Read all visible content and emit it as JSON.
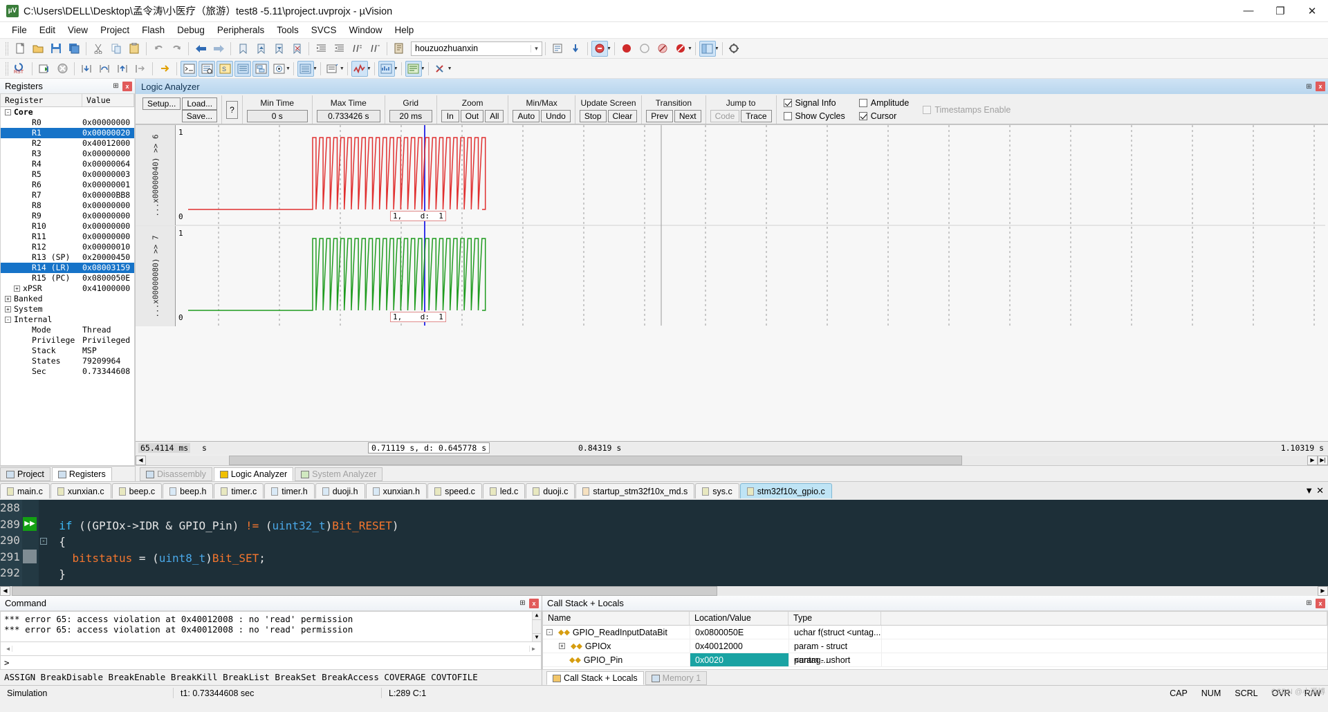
{
  "window": {
    "title": "C:\\Users\\DELL\\Desktop\\孟令涛\\小医疗（旅游）test8 -5.11\\project.uvprojx - µVision",
    "logo_text": "µV",
    "minimize": "—",
    "maximize": "❐",
    "close": "✕"
  },
  "menu": [
    "File",
    "Edit",
    "View",
    "Project",
    "Flash",
    "Debug",
    "Peripherals",
    "Tools",
    "SVCS",
    "Window",
    "Help"
  ],
  "toolbar": {
    "target_combo": "houzuozhuanxin",
    "combo_arrow": "▼"
  },
  "registers_pane": {
    "caption": "Registers",
    "pin": "⊞",
    "close": "x",
    "headers": [
      "Register",
      "Value"
    ],
    "rows": [
      {
        "name": "Core",
        "value": "",
        "indent": 0,
        "toggle": "-",
        "bold": true,
        "selected": false
      },
      {
        "name": "R0",
        "value": "0x00000000",
        "indent": 2,
        "toggle": "",
        "bold": false,
        "selected": false
      },
      {
        "name": "R1",
        "value": "0x00000020",
        "indent": 2,
        "toggle": "",
        "bold": false,
        "selected": true
      },
      {
        "name": "R2",
        "value": "0x40012000",
        "indent": 2,
        "toggle": "",
        "bold": false,
        "selected": false
      },
      {
        "name": "R3",
        "value": "0x00000000",
        "indent": 2,
        "toggle": "",
        "bold": false,
        "selected": false
      },
      {
        "name": "R4",
        "value": "0x00000064",
        "indent": 2,
        "toggle": "",
        "bold": false,
        "selected": false
      },
      {
        "name": "R5",
        "value": "0x00000003",
        "indent": 2,
        "toggle": "",
        "bold": false,
        "selected": false
      },
      {
        "name": "R6",
        "value": "0x00000001",
        "indent": 2,
        "toggle": "",
        "bold": false,
        "selected": false
      },
      {
        "name": "R7",
        "value": "0x00000BB8",
        "indent": 2,
        "toggle": "",
        "bold": false,
        "selected": false
      },
      {
        "name": "R8",
        "value": "0x00000000",
        "indent": 2,
        "toggle": "",
        "bold": false,
        "selected": false
      },
      {
        "name": "R9",
        "value": "0x00000000",
        "indent": 2,
        "toggle": "",
        "bold": false,
        "selected": false
      },
      {
        "name": "R10",
        "value": "0x00000000",
        "indent": 2,
        "toggle": "",
        "bold": false,
        "selected": false
      },
      {
        "name": "R11",
        "value": "0x00000000",
        "indent": 2,
        "toggle": "",
        "bold": false,
        "selected": false
      },
      {
        "name": "R12",
        "value": "0x00000010",
        "indent": 2,
        "toggle": "",
        "bold": false,
        "selected": false
      },
      {
        "name": "R13 (SP)",
        "value": "0x20000450",
        "indent": 2,
        "toggle": "",
        "bold": false,
        "selected": false
      },
      {
        "name": "R14 (LR)",
        "value": "0x08003159",
        "indent": 2,
        "toggle": "",
        "bold": false,
        "selected": true
      },
      {
        "name": "R15 (PC)",
        "value": "0x0800050E",
        "indent": 2,
        "toggle": "",
        "bold": false,
        "selected": false
      },
      {
        "name": "xPSR",
        "value": "0x41000000",
        "indent": 1,
        "toggle": "+",
        "bold": false,
        "selected": false
      },
      {
        "name": "Banked",
        "value": "",
        "indent": 0,
        "toggle": "+",
        "bold": false,
        "selected": false
      },
      {
        "name": "System",
        "value": "",
        "indent": 0,
        "toggle": "+",
        "bold": false,
        "selected": false
      },
      {
        "name": "Internal",
        "value": "",
        "indent": 0,
        "toggle": "-",
        "bold": false,
        "selected": false
      },
      {
        "name": "Mode",
        "value": "Thread",
        "indent": 2,
        "toggle": "",
        "bold": false,
        "selected": false
      },
      {
        "name": "Privilege",
        "value": "Privileged",
        "indent": 2,
        "toggle": "",
        "bold": false,
        "selected": false
      },
      {
        "name": "Stack",
        "value": "MSP",
        "indent": 2,
        "toggle": "",
        "bold": false,
        "selected": false
      },
      {
        "name": "States",
        "value": "79209964",
        "indent": 2,
        "toggle": "",
        "bold": false,
        "selected": false
      },
      {
        "name": "Sec",
        "value": "0.73344608",
        "indent": 2,
        "toggle": "",
        "bold": false,
        "selected": false
      }
    ],
    "tabs": [
      {
        "label": "Project",
        "active": false,
        "icon": "project-icon"
      },
      {
        "label": "Registers",
        "active": true,
        "icon": "registers-icon"
      }
    ]
  },
  "logic_analyzer": {
    "caption": "Logic Analyzer",
    "pin": "⊞",
    "close": "x",
    "buttons": {
      "setup": "Setup...",
      "load": "Load...",
      "save": "Save...",
      "help": "?"
    },
    "fields": [
      {
        "label": "Min Time",
        "value": "0 s"
      },
      {
        "label": "Max Time",
        "value": "0.733426 s"
      },
      {
        "label": "Grid",
        "value": "20 ms"
      }
    ],
    "groups": [
      {
        "label": "Zoom",
        "buttons": [
          "In",
          "Out",
          "All"
        ]
      },
      {
        "label": "Min/Max",
        "buttons": [
          "Auto",
          "Undo"
        ]
      },
      {
        "label": "Update Screen",
        "buttons": [
          "Stop",
          "Clear"
        ]
      },
      {
        "label": "Transition",
        "buttons": [
          "Prev",
          "Next"
        ]
      },
      {
        "label": "Jump to",
        "buttons": [
          "Code",
          "Trace"
        ]
      }
    ],
    "checkboxes": [
      {
        "label": "Signal Info",
        "checked": true,
        "disabled": false
      },
      {
        "label": "Show Cycles",
        "checked": false,
        "disabled": false
      },
      {
        "label": "Amplitude",
        "checked": false,
        "disabled": false
      },
      {
        "label": "Cursor",
        "checked": true,
        "disabled": false
      },
      {
        "label": "Timestamps Enable",
        "checked": false,
        "disabled": true
      }
    ],
    "signals": [
      {
        "label": "...x00000040) >> 6",
        "color": "#e03030",
        "max": "1",
        "min": "0",
        "cursor_text": "1,    d:  1"
      },
      {
        "label": "...x00000080) >> 7",
        "color": "#1f9b1f",
        "max": "1",
        "min": "0",
        "cursor_text": "1,    d:  1"
      }
    ],
    "timebar": {
      "left_value": "65.4114 ms",
      "left_unit": "s",
      "cursor_value": "0.71119 s,    d: 0.645778 s",
      "mid_value": "0.84319 s",
      "right_value": "1.10319 s"
    },
    "tabs": [
      {
        "label": "Disassembly",
        "active": false,
        "icon": "disassembly-icon"
      },
      {
        "label": "Logic Analyzer",
        "active": true,
        "icon": "logic-analyzer-icon"
      },
      {
        "label": "System Analyzer",
        "active": false,
        "icon": "system-analyzer-icon"
      }
    ]
  },
  "editor": {
    "tabs": [
      {
        "label": "main.c",
        "kind": "c",
        "active": false
      },
      {
        "label": "xunxian.c",
        "kind": "c",
        "active": false
      },
      {
        "label": "beep.c",
        "kind": "c",
        "active": false
      },
      {
        "label": "beep.h",
        "kind": "h",
        "active": false
      },
      {
        "label": "timer.c",
        "kind": "c",
        "active": false
      },
      {
        "label": "timer.h",
        "kind": "h",
        "active": false
      },
      {
        "label": "duoji.h",
        "kind": "h",
        "active": false
      },
      {
        "label": "xunxian.h",
        "kind": "h",
        "active": false
      },
      {
        "label": "speed.c",
        "kind": "c",
        "active": false
      },
      {
        "label": "led.c",
        "kind": "c",
        "active": false
      },
      {
        "label": "duoji.c",
        "kind": "c",
        "active": false
      },
      {
        "label": "startup_stm32f10x_md.s",
        "kind": "s",
        "active": false
      },
      {
        "label": "sys.c",
        "kind": "c",
        "active": false
      },
      {
        "label": "stm32f10x_gpio.c",
        "kind": "c",
        "active": true
      }
    ],
    "tab_nav_down": "▼",
    "tab_nav_close": "✕",
    "lines": [
      {
        "num": "288",
        "marker": "",
        "fold": "",
        "tokens": []
      },
      {
        "num": "289",
        "marker": "arrow",
        "fold": "",
        "tokens": [
          {
            "t": "  ",
            "c": "pl"
          },
          {
            "t": "if",
            "c": "kw"
          },
          {
            "t": " ((GPIOx->IDR & GPIO_Pin) ",
            "c": "pl"
          },
          {
            "t": "!=",
            "c": "mac"
          },
          {
            "t": " (",
            "c": "pl"
          },
          {
            "t": "uint32_t",
            "c": "ty"
          },
          {
            "t": ")",
            "c": "pl"
          },
          {
            "t": "Bit_RESET",
            "c": "mac"
          },
          {
            "t": ")",
            "c": "pl"
          }
        ]
      },
      {
        "num": "290",
        "marker": "",
        "fold": "-",
        "tokens": [
          {
            "t": "  {",
            "c": "pl"
          }
        ]
      },
      {
        "num": "291",
        "marker": "",
        "fold": "",
        "tokens": [
          {
            "t": "    bitstatus ",
            "c": "mac"
          },
          {
            "t": "= (",
            "c": "pl"
          },
          {
            "t": "uint8_t",
            "c": "ty"
          },
          {
            "t": ")",
            "c": "pl"
          },
          {
            "t": "Bit_SET",
            "c": "mac"
          },
          {
            "t": ";",
            "c": "pl"
          }
        ]
      },
      {
        "num": "292",
        "marker": "",
        "fold": "",
        "tokens": [
          {
            "t": "  }",
            "c": "pl"
          }
        ]
      }
    ]
  },
  "command_pane": {
    "caption": "Command",
    "pin": "⊞",
    "close": "x",
    "output": [
      "*** error 65: access violation at 0x40012008 : no 'read' permission",
      "*** error 65: access violation at 0x40012008 : no 'read' permission"
    ],
    "prompt": ">",
    "hints": "ASSIGN BreakDisable BreakEnable BreakKill BreakList BreakSet BreakAccess COVERAGE COVTOFILE"
  },
  "call_stack": {
    "caption": "Call Stack + Locals",
    "pin": "⊞",
    "close": "x",
    "headers": [
      "Name",
      "Location/Value",
      "Type"
    ],
    "rows": [
      {
        "name": "GPIO_ReadInputDataBit",
        "location": "0x0800050E",
        "type": "uchar f(struct <untag...",
        "indent": 0,
        "toggle": "-",
        "icon": "function-icon",
        "highlight": false
      },
      {
        "name": "GPIOx",
        "location": "0x40012000",
        "type": "param - struct <untag...",
        "indent": 1,
        "toggle": "+",
        "icon": "param-icon",
        "highlight": false
      },
      {
        "name": "GPIO_Pin",
        "location": "0x0020",
        "type": "param - ushort",
        "indent": 1,
        "toggle": "",
        "icon": "param-icon",
        "highlight": true
      }
    ],
    "tabs": [
      {
        "label": "Call Stack + Locals",
        "active": true,
        "icon": "callstack-icon"
      },
      {
        "label": "Memory 1",
        "active": false,
        "icon": "memory-icon"
      }
    ]
  },
  "statusbar": {
    "mode": "Simulation",
    "time": "t1: 0.73344608 sec",
    "position": "L:289 C:1",
    "indicators": [
      "CAP",
      "NUM",
      "SCRL",
      "OVR",
      "R/W"
    ],
    "watermark": "CSDN @小源博"
  },
  "colors": {
    "selection_blue": "#1673c8",
    "signal_red": "#e03030",
    "signal_green": "#1f9b1f",
    "cursor_blue": "#3535e8",
    "highlight_teal": "#1aa3a3",
    "editor_bg": "#1d2f38",
    "tab_active": "#bfe4f5"
  }
}
